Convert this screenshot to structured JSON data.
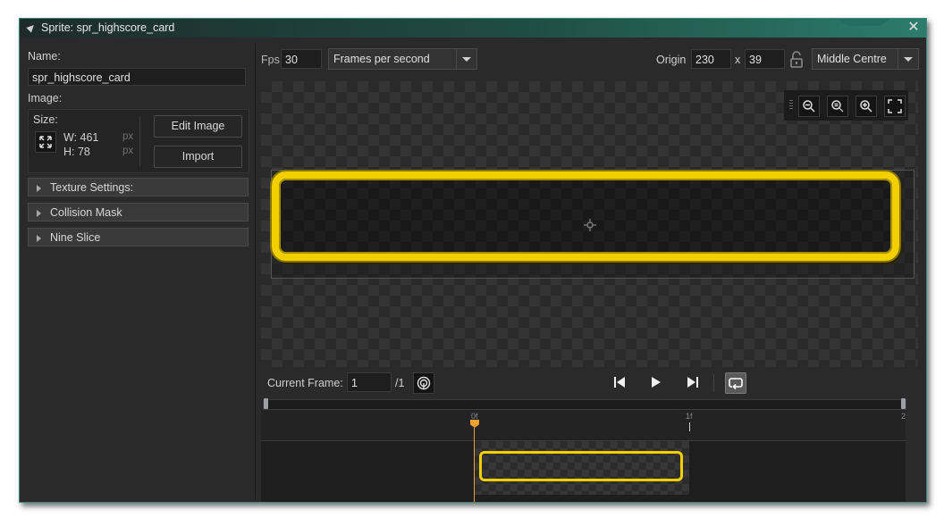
{
  "window": {
    "title": "Sprite: spr_highscore_card",
    "close_glyph": "✕"
  },
  "left_panel": {
    "name_label": "Name:",
    "name_value": "spr_highscore_card",
    "image_label": "Image:",
    "size_label": "Size:",
    "width_text": "W: 461",
    "height_text": "H: 78",
    "unit": "px",
    "edit_image_label": "Edit Image",
    "import_label": "Import",
    "sections": [
      {
        "label": "Texture Settings:"
      },
      {
        "label": "Collision Mask"
      },
      {
        "label": "Nine Slice"
      }
    ]
  },
  "toolbar": {
    "fps_label": "Fps",
    "fps_value": "30",
    "speed_mode": "Frames per second",
    "origin_label": "Origin",
    "origin_x": "230",
    "origin_sep": "x",
    "origin_y": "39",
    "origin_preset": "Middle Centre"
  },
  "playback": {
    "current_frame_label": "Current Frame:",
    "current_frame_value": "1",
    "frame_total": "/1"
  },
  "timeline": {
    "ticks": [
      "0f",
      "1f",
      "2"
    ]
  },
  "colors": {
    "accent_teal": "#2c7c6c",
    "sprite_yellow": "#f2d000",
    "playhead_orange": "#f0a030",
    "panel_bg": "#2a2a2a"
  }
}
